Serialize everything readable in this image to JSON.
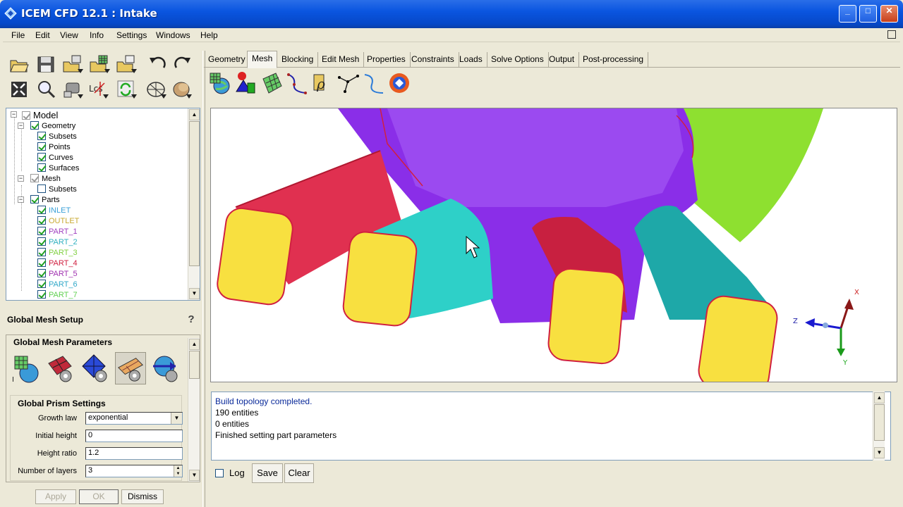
{
  "window": {
    "title": "ICEM CFD 12.1 : Intake",
    "minimize_label": "_",
    "maximize_label": "□",
    "close_label": "✕"
  },
  "menu": {
    "items": [
      "File",
      "Edit",
      "View",
      "Info",
      "Settings",
      "Windows",
      "Help"
    ]
  },
  "tabs": {
    "items": [
      "Geometry",
      "Mesh",
      "Blocking",
      "Edit Mesh",
      "Properties",
      "Constraints",
      "Loads",
      "Solve Options",
      "Output",
      "Post-processing"
    ],
    "active": "Mesh"
  },
  "tree": {
    "root": "Model",
    "geometry": "Geometry",
    "geometry_children": [
      "Subsets",
      "Points",
      "Curves",
      "Surfaces"
    ],
    "mesh": "Mesh",
    "mesh_children": [
      "Subsets"
    ],
    "parts": "Parts",
    "part_items": [
      {
        "name": "INLET",
        "color": "#3aa0d8"
      },
      {
        "name": "OUTLET",
        "color": "#c8a830"
      },
      {
        "name": "PART_1",
        "color": "#a040c0"
      },
      {
        "name": "PART_2",
        "color": "#30b0c0"
      },
      {
        "name": "PART_3",
        "color": "#80d040"
      },
      {
        "name": "PART_4",
        "color": "#d02040"
      },
      {
        "name": "PART_5",
        "color": "#a030b0"
      },
      {
        "name": "PART_6",
        "color": "#30a8c8"
      },
      {
        "name": "PART_7",
        "color": "#60d050"
      }
    ]
  },
  "setup": {
    "title": "Global Mesh Setup",
    "help_glyph": "?",
    "params_label": "Global Mesh Parameters",
    "prism_title": "Global Prism Settings",
    "fields": [
      {
        "label": "Growth law",
        "value": "exponential",
        "kind": "combo"
      },
      {
        "label": "Initial height",
        "value": "0",
        "kind": "text"
      },
      {
        "label": "Height ratio",
        "value": "1.2",
        "kind": "text"
      },
      {
        "label": "Number of layers",
        "value": "3",
        "kind": "spin"
      }
    ],
    "buttons": {
      "apply": "Apply",
      "ok": "OK",
      "dismiss": "Dismiss"
    }
  },
  "viewport": {
    "axis_x": "X",
    "axis_y": "Y",
    "axis_z": "Z",
    "colors": {
      "purple": "#8a2ee8",
      "red": "#e0304a",
      "teal": "#2ec8c0",
      "yellow": "#f8e040",
      "green": "#90e030"
    }
  },
  "messages": {
    "lines": [
      "Build topology completed.",
      "190 entities",
      "0 entities",
      "Finished setting part parameters"
    ],
    "log_label": "Log",
    "save_label": "Save",
    "clear_label": "Clear"
  },
  "icons": {
    "toolbar": [
      "open-icon",
      "save-icon",
      "import-icon",
      "mesh-import-icon",
      "export-icon",
      "undo-icon",
      "redo-icon",
      "fit-window-icon",
      "zoom-icon",
      "measure-icon",
      "local-coords-icon",
      "refresh-icon",
      "wireframe-icon",
      "solid-icon"
    ]
  }
}
